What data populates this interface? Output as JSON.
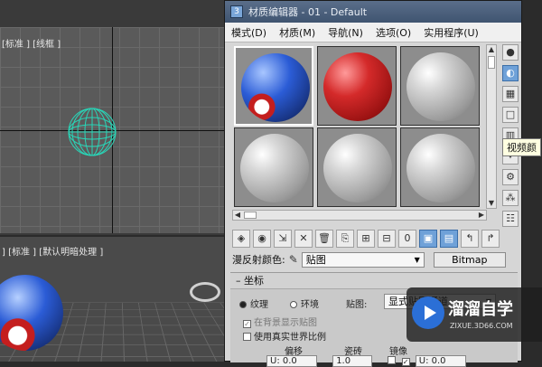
{
  "viewport_top": {
    "label": "[标准 ] [线框 ]"
  },
  "viewport_bottom": {
    "label": "] [标准 ] [默认明暗处理 ]"
  },
  "window": {
    "title": "材质编辑器 - 01 - Default"
  },
  "menu": {
    "items": [
      "模式(D)",
      "材质(M)",
      "导航(N)",
      "选项(O)",
      "实用程序(U)"
    ]
  },
  "slots": [
    {
      "material": "ball"
    },
    {
      "material": "red"
    },
    {
      "material": "grey"
    },
    {
      "material": "grey"
    },
    {
      "material": "grey"
    },
    {
      "material": "grey"
    }
  ],
  "tooltip": "视频颜",
  "diffuse": {
    "label": "漫反射颜色:",
    "value": "贴图",
    "button": "Bitmap"
  },
  "rollout": {
    "title": "坐标",
    "texture_label": "纹理",
    "environment_label": "环境",
    "mapping_label": "贴图:",
    "mapping_value": "显式贴图通道",
    "show_in_bg": "在背景显示贴图",
    "real_world": "使用真实世界比例",
    "offset_label": "偏移",
    "tiling_label": "瓷砖",
    "mirror_label": "镜像",
    "u_offset": "U: 0.0",
    "u_tiling": "1.0",
    "u_angle": "U: 0.0"
  },
  "watermark": {
    "main": "溜溜自学",
    "sub": "ZIXUE.3D66.COM"
  }
}
